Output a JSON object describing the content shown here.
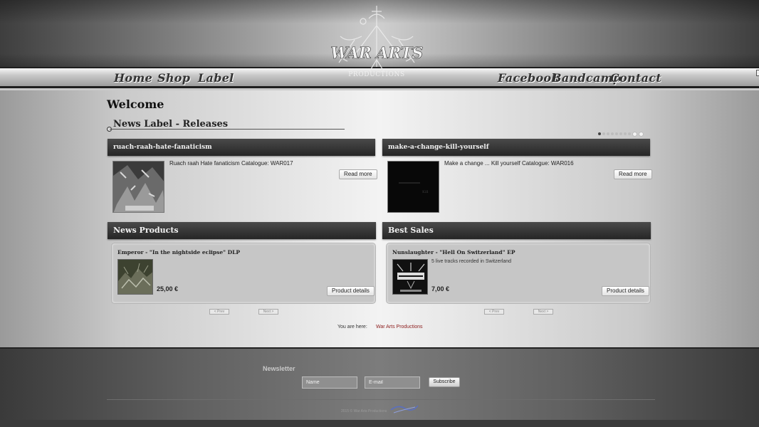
{
  "brand": {
    "logo_text": "WAR ARTS",
    "logo_subtitle": "PRODUCTIONS"
  },
  "nav": {
    "left": [
      {
        "label": "Home"
      },
      {
        "label": "Shop"
      },
      {
        "label": "Label"
      }
    ],
    "right": [
      {
        "label": "Facebook"
      },
      {
        "label": "Bandcamp"
      },
      {
        "label": "Contact"
      }
    ]
  },
  "main": {
    "welcome": "Welcome",
    "label_section_title": "News Label - Releases",
    "slider": {
      "dot_count": 10,
      "active_index": 0
    },
    "releases": [
      {
        "title": "ruach-raah-hate-fanaticism",
        "description": "Ruach raah Hate fanaticism Catalogue: WAR017",
        "read_more": "Read more"
      },
      {
        "title": "make-a-change-kill-yourself",
        "description": "Make a change ... Kill yourself Catalogue: WAR016",
        "read_more": "Read more"
      }
    ],
    "news_products": {
      "title": "News Products",
      "item": {
        "name": "Emperor - \"In the nightside eclipse\" DLP",
        "price": "25,00 €",
        "details": "Product details"
      },
      "prev": "< Prev",
      "next": "Next >"
    },
    "best_sales": {
      "title": "Best Sales",
      "item": {
        "name": "Nunslaughter - \"Hell On Switzerland\" EP",
        "description": "5 live tracks recorded in Switzerland",
        "price": "7,00 €",
        "details": "Product details"
      },
      "prev": "< Prev",
      "next": "Next >"
    },
    "breadcrumb": {
      "label": "You are here:",
      "link": "War Arts Productions"
    }
  },
  "footer": {
    "newsletter_title": "Newsletter",
    "name_placeholder": "Name",
    "email_placeholder": "E-mail",
    "subscribe_label": "Subscribe",
    "copyright": "2015 © War Arts Productions"
  },
  "colors": {
    "panel_header": "#2f2f2f",
    "breadcrumb_link": "#8b1a1a",
    "footer_bg": "#606060"
  }
}
